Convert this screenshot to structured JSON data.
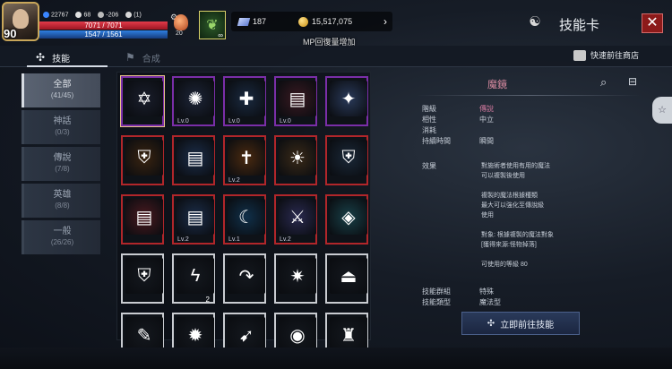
{
  "player": {
    "level": "90",
    "hp": "7071 / 7071",
    "mp": "1547 / 1561",
    "stat1": "22767",
    "stat2": "68",
    "stat3": "-206",
    "stat4": "(1)"
  },
  "potion": {
    "count": "20"
  },
  "pet": {
    "label": "∞"
  },
  "currency": {
    "gems": "187",
    "gold": "15,517,075"
  },
  "notice": "MP回復量增加",
  "header": {
    "title": "技能卡",
    "close": "✕"
  },
  "tabs": [
    {
      "label": "技能"
    },
    {
      "label": "合成"
    }
  ],
  "shortcut": "快速前往商店",
  "categories": [
    {
      "name": "全部",
      "count": "(41/45)"
    },
    {
      "name": "神話",
      "count": "(0/3)"
    },
    {
      "name": "傳說",
      "count": "(7/8)"
    },
    {
      "name": "英雄",
      "count": "(8/8)"
    },
    {
      "name": "一般",
      "count": "(26/26)"
    }
  ],
  "cards": [
    {
      "icon": "✡",
      "lv": "",
      "qty": "",
      "frame": "purple",
      "bg": "#1a1e2c"
    },
    {
      "icon": "✺",
      "lv": "Lv.0",
      "qty": "",
      "frame": "purple",
      "bg": "#1d2538"
    },
    {
      "icon": "✚",
      "lv": "Lv.0",
      "qty": "",
      "frame": "purple",
      "bg": "#1a2a40"
    },
    {
      "icon": "▤",
      "lv": "Lv.0",
      "qty": "",
      "frame": "purple",
      "bg": "#3a1a22"
    },
    {
      "icon": "✦",
      "lv": "",
      "qty": "",
      "frame": "purple",
      "bg": "#2a3a5a"
    },
    {
      "icon": "⛨",
      "lv": "",
      "qty": "",
      "frame": "red",
      "bg": "#3a2410"
    },
    {
      "icon": "▤",
      "lv": "",
      "qty": "",
      "frame": "red",
      "bg": "#1c2e4a"
    },
    {
      "icon": "✝",
      "lv": "Lv.2",
      "qty": "",
      "frame": "red",
      "bg": "#4a2a10"
    },
    {
      "icon": "☀",
      "lv": "",
      "qty": "",
      "frame": "red",
      "bg": "#3a2a18"
    },
    {
      "icon": "⛨",
      "lv": "",
      "qty": "",
      "frame": "red",
      "bg": "#1a2838"
    },
    {
      "icon": "▤",
      "lv": "",
      "qty": "",
      "frame": "red",
      "bg": "#4a1a20"
    },
    {
      "icon": "▤",
      "lv": "Lv.2",
      "qty": "",
      "frame": "red",
      "bg": "#1c2e4a"
    },
    {
      "icon": "☾",
      "lv": "Lv.1",
      "qty": "",
      "frame": "red",
      "bg": "#10304a"
    },
    {
      "icon": "⚔",
      "lv": "Lv.2",
      "qty": "",
      "frame": "red",
      "bg": "#2a2a50"
    },
    {
      "icon": "◈",
      "lv": "",
      "qty": "",
      "frame": "red",
      "bg": "#184048"
    },
    {
      "icon": "⛨",
      "lv": "",
      "qty": "",
      "frame": "white",
      "bg": "#14181e"
    },
    {
      "icon": "ϟ",
      "lv": "",
      "qty": "2",
      "frame": "white",
      "bg": "#14181e"
    },
    {
      "icon": "↷",
      "lv": "",
      "qty": "",
      "frame": "white",
      "bg": "#14181e"
    },
    {
      "icon": "✷",
      "lv": "",
      "qty": "",
      "frame": "white",
      "bg": "#14181e"
    },
    {
      "icon": "⏏",
      "lv": "",
      "qty": "",
      "frame": "white",
      "bg": "#14181e"
    },
    {
      "icon": "✎",
      "lv": "",
      "qty": "",
      "frame": "white",
      "bg": "#14181e"
    },
    {
      "icon": "✹",
      "lv": "",
      "qty": "",
      "frame": "white",
      "bg": "#14181e"
    },
    {
      "icon": "➹",
      "lv": "",
      "qty": "",
      "frame": "white",
      "bg": "#14181e"
    },
    {
      "icon": "◉",
      "lv": "",
      "qty": "",
      "frame": "white",
      "bg": "#14181e"
    },
    {
      "icon": "♜",
      "lv": "",
      "qty": "",
      "frame": "white",
      "bg": "#14181e"
    }
  ],
  "detail": {
    "title": "魔鏡",
    "rows": [
      {
        "k": "階級",
        "v": "傳說",
        "vcolor": "#d47aa0"
      },
      {
        "k": "相性",
        "v": "中立",
        "vcolor": "#c5ccd6"
      },
      {
        "k": "消耗",
        "v": "",
        "vcolor": "#c5ccd6"
      },
      {
        "k": "持續時間",
        "v": "瞬間",
        "vcolor": "#c5ccd6"
      }
    ],
    "effect_label": "效果",
    "effect_lines": [
      "對施術者使用有用的魔法",
      "可以複製後使用",
      "",
      "複製的魔法根據種類",
      "最大可以強化至傳說級",
      "使用",
      "",
      "對象: 根據複製的魔法對象",
      "[獲得來源:怪物掉落]",
      "",
      "可使用的等級 80"
    ],
    "group_label": "技能群組",
    "group_value": "特殊",
    "type_label": "技能類型",
    "type_value": "魔法型",
    "go_button": "立即前往技能"
  }
}
